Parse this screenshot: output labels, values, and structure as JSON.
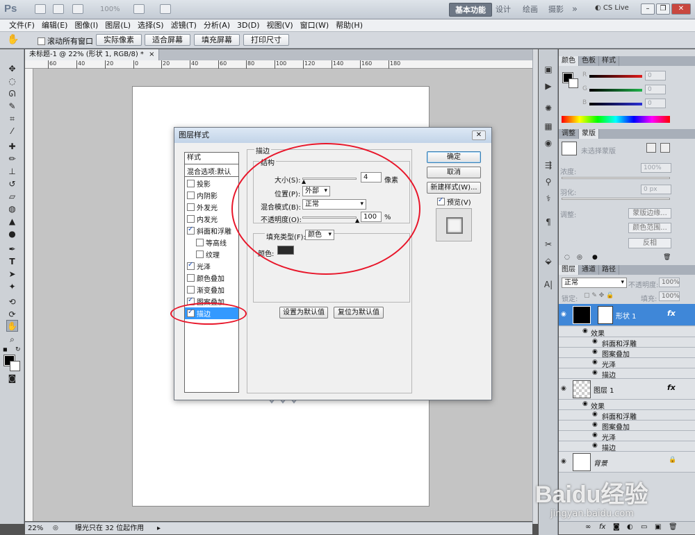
{
  "app": {
    "logo": "Ps",
    "zoom": "100%",
    "workspace": {
      "basic": "基本功能",
      "design": "设计",
      "painting": "绘画",
      "photography": "摄影",
      "more": "»"
    },
    "cs_live": "CS Live"
  },
  "menu": [
    "文件(F)",
    "编辑(E)",
    "图像(I)",
    "图层(L)",
    "选择(S)",
    "滤镜(T)",
    "分析(A)",
    "3D(D)",
    "视图(V)",
    "窗口(W)",
    "帮助(H)"
  ],
  "options": {
    "scroll_all": "滚动所有窗口",
    "actual_pixels": "实际像素",
    "fit_screen": "适合屏幕",
    "fill_screen": "填充屏幕",
    "print_size": "打印尺寸"
  },
  "document": {
    "tab_title": "未标题-1 @ 22% (形状 1, RGB/8) *",
    "tab_close": "×",
    "ruler_ticks": [
      "60",
      "40",
      "20",
      "0",
      "20",
      "40",
      "60",
      "80",
      "100",
      "120",
      "140",
      "160",
      "180"
    ],
    "status_zoom": "22%",
    "status_info": "曝光只在 32 位起作用"
  },
  "color_panel": {
    "tabs": [
      "颜色",
      "色板",
      "样式"
    ],
    "channels": [
      {
        "label": "R",
        "value": "0",
        "color": "#e01b1b"
      },
      {
        "label": "G",
        "value": "0",
        "color": "#1fb34a"
      },
      {
        "label": "B",
        "value": "0",
        "color": "#2a2fd6"
      }
    ]
  },
  "adjust_panel": {
    "tabs": [
      "调整",
      "蒙版"
    ],
    "no_mask": "未选择蒙版",
    "density_label": "浓度:",
    "density_value": "100%",
    "feather_label": "羽化:",
    "feather_value": "0 px",
    "refine_label": "调整:",
    "mask_edge": "蒙版边缘...",
    "color_range": "颜色范围...",
    "invert": "反相"
  },
  "layers_panel": {
    "tabs": [
      "图层",
      "通道",
      "路径"
    ],
    "blend_mode": "正常",
    "opacity_label": "不透明度:",
    "opacity_value": "100%",
    "lock_label": "锁定:",
    "fill_label": "填充:",
    "fill_value": "100%",
    "layers": [
      {
        "name": "形状 1",
        "effects_label": "效果",
        "effects": [
          "斜面和浮雕",
          "图案叠加",
          "光泽",
          "描边"
        ]
      },
      {
        "name": "图层 1",
        "effects_label": "效果",
        "effects": [
          "斜面和浮雕",
          "图案叠加",
          "光泽",
          "描边"
        ]
      },
      {
        "name": "背景"
      }
    ],
    "fx": "fx"
  },
  "dialog": {
    "title": "图层样式",
    "close": "✕",
    "styles_header": "样式",
    "blend_options": "混合选项:默认",
    "styles": [
      {
        "label": "投影",
        "checked": false,
        "indent": false
      },
      {
        "label": "内阴影",
        "checked": false,
        "indent": false
      },
      {
        "label": "外发光",
        "checked": false,
        "indent": false
      },
      {
        "label": "内发光",
        "checked": false,
        "indent": false
      },
      {
        "label": "斜面和浮雕",
        "checked": true,
        "indent": false
      },
      {
        "label": "等高线",
        "checked": false,
        "indent": true
      },
      {
        "label": "纹理",
        "checked": false,
        "indent": true
      },
      {
        "label": "光泽",
        "checked": true,
        "indent": false
      },
      {
        "label": "颜色叠加",
        "checked": false,
        "indent": false
      },
      {
        "label": "渐变叠加",
        "checked": false,
        "indent": false
      },
      {
        "label": "图案叠加",
        "checked": true,
        "indent": false
      },
      {
        "label": "描边",
        "checked": true,
        "indent": false
      }
    ],
    "section_title": "描边",
    "structure_title": "结构",
    "size_label": "大小(S):",
    "size_value": "4",
    "size_unit": "像素",
    "position_label": "位置(P):",
    "position_value": "外部",
    "blend_label": "混合模式(B):",
    "blend_value": "正常",
    "opacity_label": "不透明度(O):",
    "opacity_value": "100",
    "opacity_unit": "%",
    "fill_type_label": "填充类型(F):",
    "fill_type_value": "颜色",
    "color_label": "颜色:",
    "stroke_color": "#2a2a2a",
    "set_default": "设置为默认值",
    "reset_default": "复位为默认值",
    "ok": "确定",
    "cancel": "取消",
    "new_style": "新建样式(W)...",
    "preview": "预览(V)"
  },
  "watermark": {
    "brand": "Baidu经验",
    "url": "jingyan.baidu.com"
  }
}
